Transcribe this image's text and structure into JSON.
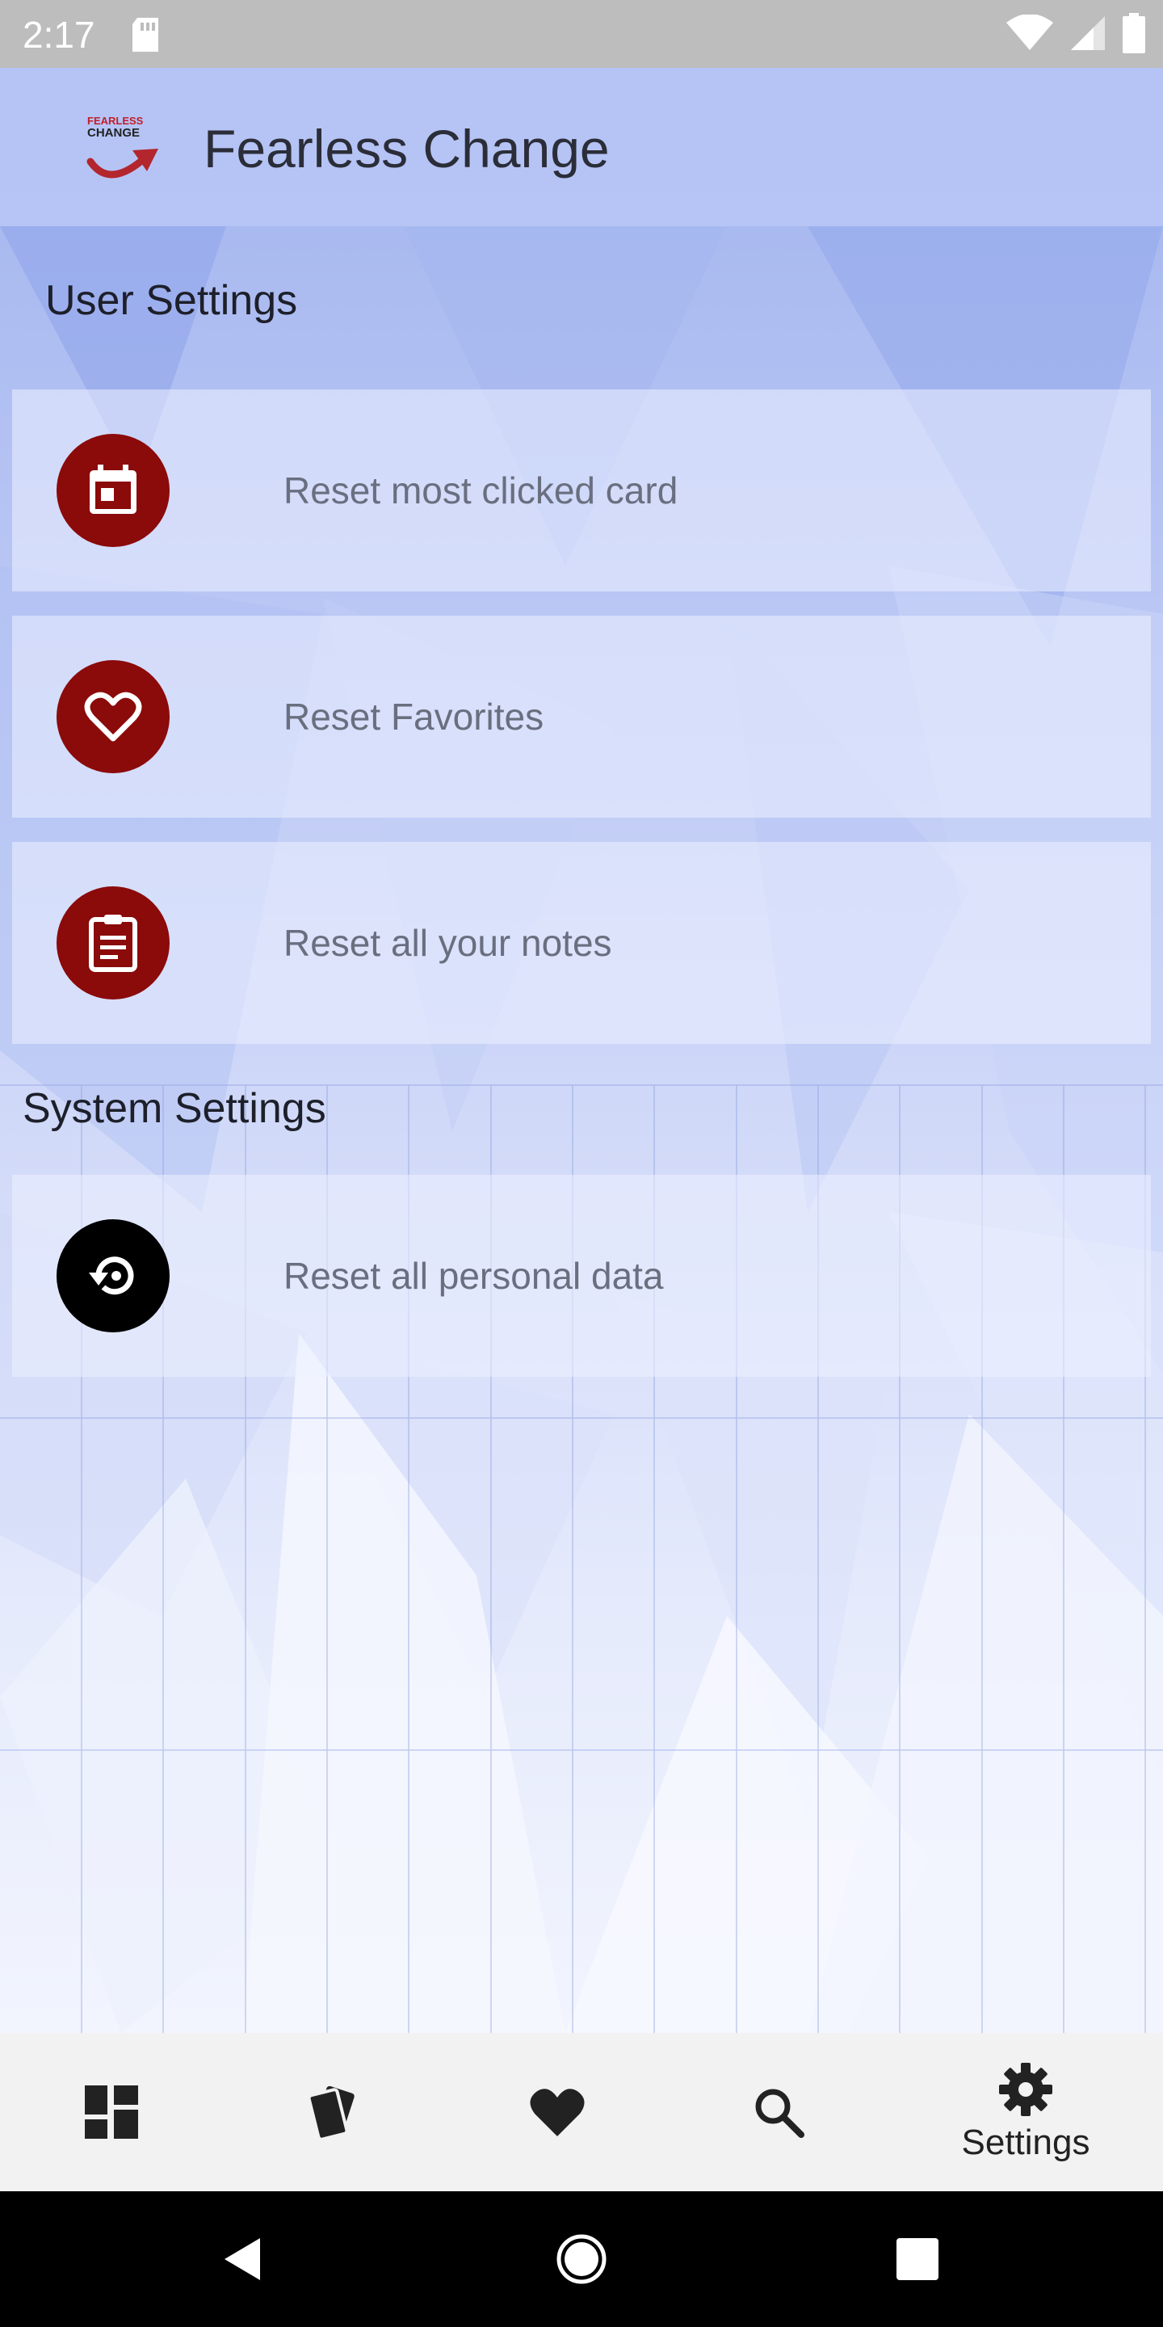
{
  "status_bar": {
    "time": "2:17",
    "icons": [
      "sd-card-icon",
      "wifi-icon",
      "cell-signal-icon",
      "battery-icon"
    ]
  },
  "app_bar": {
    "logo_top": "FEARLESS",
    "logo_bottom": "CHANGE",
    "title": "Fearless Change"
  },
  "user_settings": {
    "header": "User Settings",
    "items": [
      {
        "label": "Reset most clicked card",
        "icon": "calendar-icon",
        "color": "#8b0a0a"
      },
      {
        "label": "Reset Favorites",
        "icon": "heart-outline-icon",
        "color": "#8b0a0a"
      },
      {
        "label": "Reset all your notes",
        "icon": "clipboard-icon",
        "color": "#8b0a0a"
      }
    ]
  },
  "system_settings": {
    "header": "System Settings",
    "items": [
      {
        "label": "Reset all personal data",
        "icon": "restore-icon",
        "color": "#000000"
      }
    ]
  },
  "bottom_nav": {
    "items": [
      {
        "icon": "dashboard-icon",
        "label": ""
      },
      {
        "icon": "cards-icon",
        "label": ""
      },
      {
        "icon": "heart-icon",
        "label": ""
      },
      {
        "icon": "search-icon",
        "label": ""
      },
      {
        "icon": "settings-icon",
        "label": "Settings",
        "active": true
      }
    ]
  },
  "system_nav": {
    "items": [
      "back-icon",
      "home-icon",
      "recents-icon"
    ]
  },
  "colors": {
    "accent_red": "#8b0a0a",
    "appbar": "#bac8f6",
    "background": "#e3e8fb"
  }
}
